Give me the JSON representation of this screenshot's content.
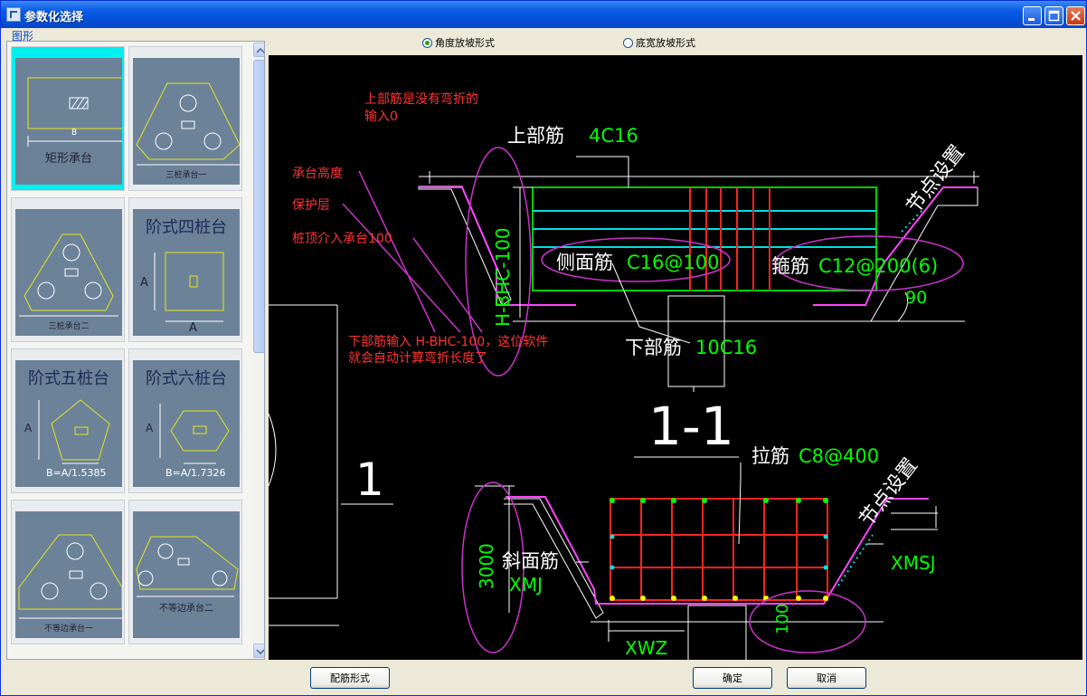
{
  "window": {
    "title": "参数化选择"
  },
  "left": {
    "group_label": "图形",
    "thumbs": [
      {
        "caption": "矩形承台",
        "dim_label": "B"
      },
      {
        "caption": "三桩承台一"
      },
      {
        "caption": "三桩承台二"
      },
      {
        "caption": "阶式四桩台",
        "dim_a": "A",
        "dim_b": "A"
      },
      {
        "caption": "阶式五桩台",
        "dim_a": "A",
        "dim_b": "B=A/1.5385"
      },
      {
        "caption": "阶式六桩台",
        "dim_a": "A",
        "dim_b": "B=A/1.7326"
      },
      {
        "caption": "不等边承台一"
      },
      {
        "caption": "不等边承台二"
      }
    ]
  },
  "options": {
    "angle": "角度放坡形式",
    "width": "底宽放坡形式",
    "selected": "angle"
  },
  "drawing": {
    "note1": "上部筋是没有弯折的",
    "note2": "输入0",
    "label_height": "承台高度",
    "label_cover": "保护层",
    "label_pile": "桩顶介入承台100",
    "note3": "下部筋输入 H-BHC-100，这位软件",
    "note4": "就会自动计算弯折长度了",
    "top_bar": "上部筋",
    "top_bar_val": "4C16",
    "side_bar": "侧面筋",
    "side_bar_val": "C16@100",
    "stirrup": "箍筋",
    "stirrup_val": "C12@200(6)",
    "bottom_bar": "下部筋",
    "bottom_bar_val": "10C16",
    "vertical": "H-BHC-100",
    "angle": "90",
    "node1": "节点设置",
    "section": "1-1",
    "big_one": "1",
    "tie": "拉筋",
    "tie_val": "C8@400",
    "node2": "节点设置",
    "slope": "斜面筋",
    "xmj": "XMJ",
    "xmsj": "XMSJ",
    "xwz": "XWZ",
    "dim3000": "3000",
    "dim100": "100"
  },
  "buttons": {
    "rebar": "配筋形式",
    "ok": "确定",
    "cancel": "取消"
  }
}
